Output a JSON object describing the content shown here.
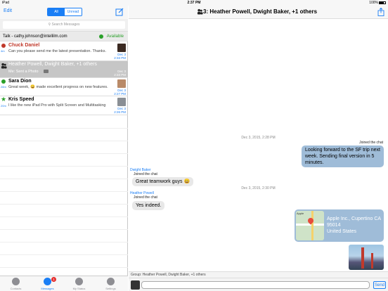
{
  "status_bar": {
    "carrier": "iPad",
    "time": "2:37 PM",
    "battery": "100%"
  },
  "left_nav": {
    "edit": "Edit",
    "tabs": [
      "All",
      "Unread"
    ]
  },
  "search": {
    "placeholder": "Search Messages"
  },
  "talk_row": {
    "account": "Talk - cathy.johnson@intellilm.com",
    "status": "Available"
  },
  "conversations": [
    {
      "name": "Chuck Daniel",
      "preview": "Can you please send me the latest presentation. Thanks.",
      "age": "4m",
      "date": "Dec 3",
      "time": "2:33 PM",
      "color": "#c0392b"
    },
    {
      "name": "Heather Powell, Dwight Baker, +1 others",
      "preview": "Me: Sent a Photo",
      "age": "",
      "date": "Dec 3",
      "time": "2:33 PM"
    },
    {
      "name": "Sara Dion",
      "preview": "Great week, 😀 made excellent progress on new features.",
      "age": "28m",
      "date": "Dec 3",
      "time": "2:27 PM",
      "color": "#2aa02a"
    },
    {
      "name": "Kris Speed",
      "preview": "I like the new iPad Pro with Split Screen and Multitasking",
      "age": "20m",
      "date": "Dec 3",
      "time": "2:26 PM",
      "color": "#2aa02a"
    }
  ],
  "tabbar": [
    {
      "label": "Contacts"
    },
    {
      "label": "Messages",
      "badge": "1"
    },
    {
      "label": "My Status"
    },
    {
      "label": "Settings"
    }
  ],
  "chat": {
    "title": "3: Heather Powell, Dwight Baker, +1 others",
    "timestamps": [
      "Dec 3, 2015, 2:28 PM",
      "Dec 3, 2015, 2:30 PM"
    ],
    "joined_me": "Joined the chat",
    "msg_out_1": "Looking forward to the SF trip next week. Sending final version in 5 minutes.",
    "sender_1": "Dwight Baker",
    "joined_1": "Joined the chat",
    "msg_in_1": "Great teamwork guys 😀",
    "sender_2": "Heather Powell",
    "joined_2": "Joined the chat",
    "msg_in_2": "Yes indeed.",
    "map": {
      "label": "Apple Inc., Cupertino CA 95014 United States",
      "line1": "Apple Inc., Cupertino CA",
      "line2": "95014",
      "line3": "United States",
      "map_caption": "Apple"
    },
    "group_label": "Group: Heather Powell, Dwight Baker, +1 others",
    "send_label": "Send"
  }
}
